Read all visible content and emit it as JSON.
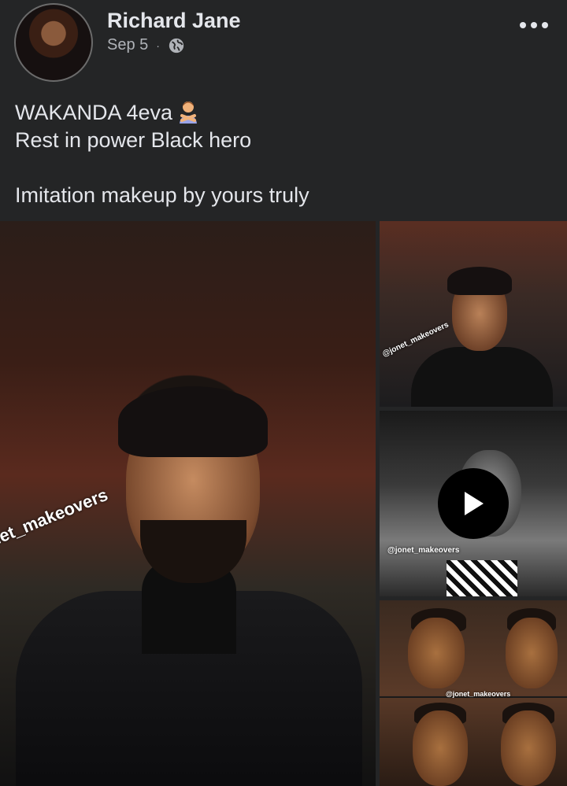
{
  "post": {
    "author": "Richard Jane",
    "date": "Sep 5",
    "separator": "·",
    "privacy_icon": "globe-icon",
    "menu_icon": "more-options-icon",
    "text_lines": [
      "WAKANDA 4eva",
      "Rest in power Black hero",
      "",
      "Imitation makeup by yours truly"
    ],
    "emoji": "person-crossing-arms-emoji"
  },
  "gallery": {
    "watermark_main": "onet_makeovers",
    "watermark_thumb1": "@jonet_makeovers",
    "watermark_thumb2": "@jonet_makeovers",
    "watermark_thumb3": "@jonet_makeovers",
    "play_icon": "play-icon"
  },
  "colors": {
    "background": "#242526",
    "primary_text": "#e4e6eb",
    "secondary_text": "#b0b3b8"
  }
}
